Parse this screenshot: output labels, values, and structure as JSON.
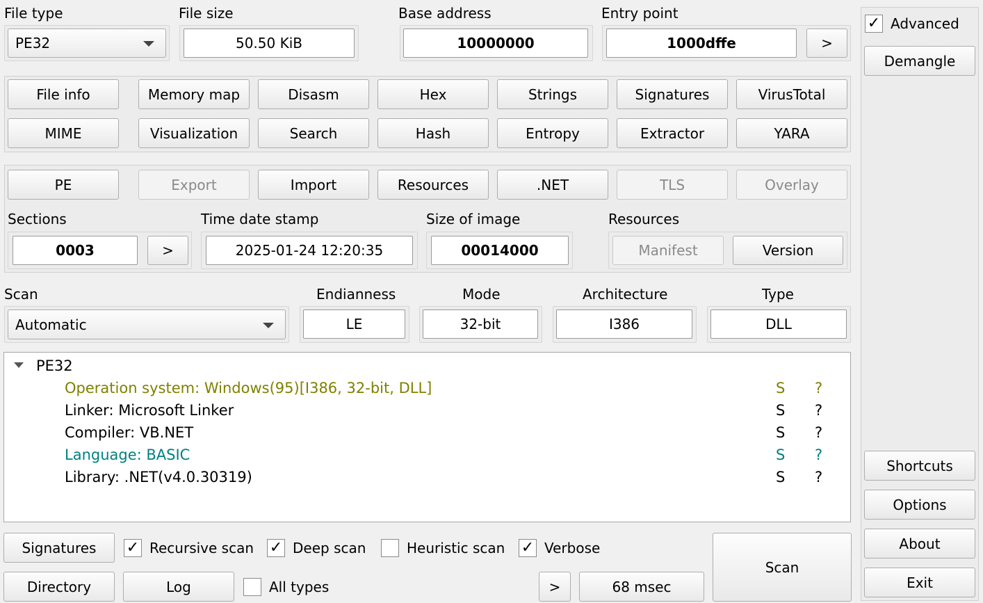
{
  "header": {
    "file_type_label": "File type",
    "file_type_value": "PE32",
    "file_size_label": "File size",
    "file_size_value": "50.50 KiB",
    "base_address_label": "Base address",
    "base_address_value": "10000000",
    "entry_point_label": "Entry point",
    "entry_point_value": "1000dffe",
    "entry_point_go": ">"
  },
  "sidebar": {
    "advanced_label": "Advanced",
    "advanced_checked": true,
    "demangle": "Demangle",
    "shortcuts": "Shortcuts",
    "options": "Options",
    "about": "About",
    "exit": "Exit"
  },
  "tools": {
    "row1": [
      "File info",
      "Memory map",
      "Disasm",
      "Hex",
      "Strings",
      "Signatures",
      "VirusTotal"
    ],
    "row2": [
      "MIME",
      "Visualization",
      "Search",
      "Hash",
      "Entropy",
      "Extractor",
      "YARA"
    ]
  },
  "pe": {
    "tabs": [
      "PE",
      "Export",
      "Import",
      "Resources",
      ".NET",
      "TLS",
      "Overlay"
    ],
    "sections_label": "Sections",
    "sections_value": "0003",
    "sections_go": ">",
    "timestamp_label": "Time date stamp",
    "timestamp_value": "2025-01-24 12:20:35",
    "size_of_image_label": "Size of image",
    "size_of_image_value": "00014000",
    "resources_label": "Resources",
    "manifest": "Manifest",
    "version": "Version"
  },
  "scan_info": {
    "scan_label": "Scan",
    "scan_value": "Automatic",
    "endianness_label": "Endianness",
    "endianness_value": "LE",
    "mode_label": "Mode",
    "mode_value": "32-bit",
    "architecture_label": "Architecture",
    "architecture_value": "I386",
    "type_label": "Type",
    "type_value": "DLL"
  },
  "results": {
    "root": "PE32",
    "items": [
      {
        "text": "Operation system: Windows(95)[I386, 32-bit, DLL]",
        "s": "S",
        "q": "?",
        "color": "#808000"
      },
      {
        "text": "Linker: Microsoft Linker",
        "s": "S",
        "q": "?",
        "color": "#000000"
      },
      {
        "text": "Compiler: VB.NET",
        "s": "S",
        "q": "?",
        "color": "#000000"
      },
      {
        "text": "Language: BASIC",
        "s": "S",
        "q": "?",
        "color": "#008080"
      },
      {
        "text": "Library: .NET(v4.0.30319)",
        "s": "S",
        "q": "?",
        "color": "#000000"
      }
    ]
  },
  "bottom": {
    "signatures": "Signatures",
    "recursive_scan": "Recursive scan",
    "recursive_checked": true,
    "deep_scan": "Deep scan",
    "deep_checked": true,
    "heuristic_scan": "Heuristic scan",
    "heuristic_checked": false,
    "verbose": "Verbose",
    "verbose_checked": true,
    "directory": "Directory",
    "log": "Log",
    "all_types": "All types",
    "all_types_checked": false,
    "more": ">",
    "elapsed": "68 msec",
    "scan": "Scan"
  },
  "icons": {
    "check": "✓",
    "expand": "triangle-down-icon",
    "dropdown": "chevron-down-icon"
  }
}
